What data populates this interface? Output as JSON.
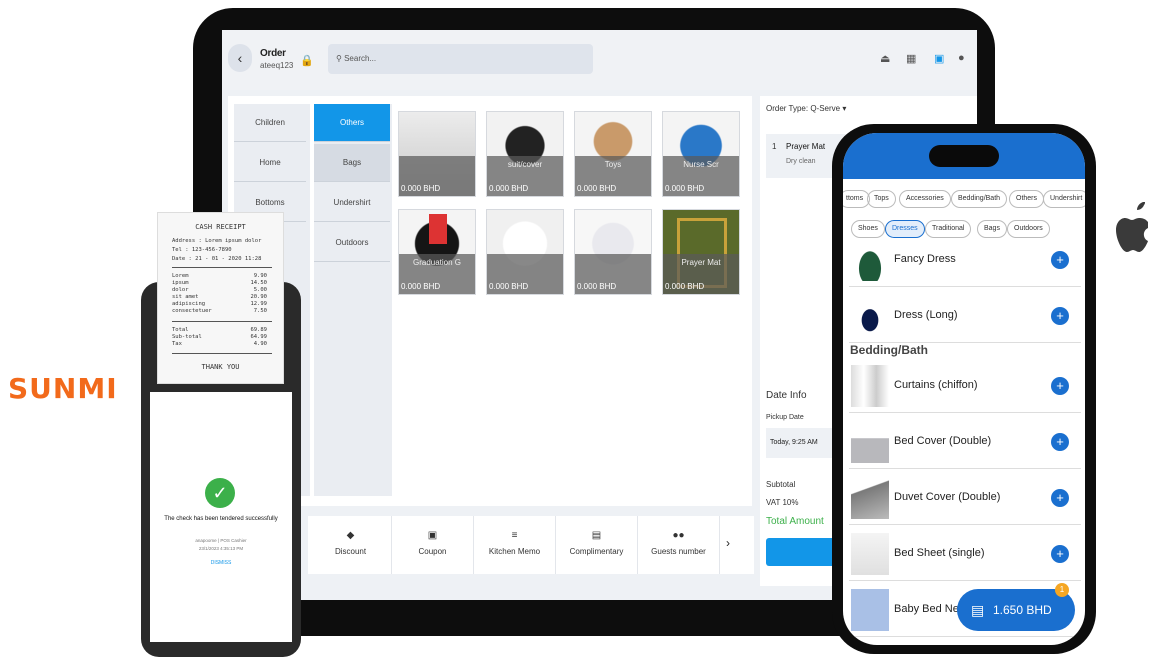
{
  "sunmi_logo": "SUNMI",
  "tablet": {
    "order_title": "Order",
    "order_user": "ateeq123",
    "search_placeholder": "Search...",
    "categories_left": [
      "Children",
      "Home",
      "Bottoms"
    ],
    "categories_right": [
      "Others",
      "Bags",
      "Undershirt",
      "Outdoors"
    ],
    "products": [
      {
        "name": "",
        "price": "0.000 BHD"
      },
      {
        "name": "suit/cover",
        "price": "0.000 BHD"
      },
      {
        "name": "Toys",
        "price": "0.000 BHD"
      },
      {
        "name": "Nurse Scr",
        "price": "0.000 BHD"
      },
      {
        "name": "Graduation G",
        "price": "0.000 BHD"
      },
      {
        "name": "",
        "price": "0.000 BHD"
      },
      {
        "name": "",
        "price": "0.000 BHD"
      },
      {
        "name": "Prayer Mat",
        "price": "0.000 BHD"
      }
    ],
    "actions": [
      "Discount",
      "Coupon",
      "Kitchen Memo",
      "Complimentary",
      "Guests number"
    ],
    "order_type": "Order Type: Q-Serve ▾",
    "line_item": {
      "qty": "1",
      "name": "Prayer Mat",
      "service": "Dry clean"
    },
    "date_info": "Date Info",
    "pickup_label": "Pickup Date",
    "pickup_value": "Today, 9:25 AM",
    "subtotal": "Subtotal",
    "vat": "VAT 10%",
    "total": "Total Amount"
  },
  "phone": {
    "top_chips": [
      "ttoms",
      "Tops",
      "Accessories",
      "Bedding/Bath",
      "Others",
      "Undershirt"
    ],
    "sub_chips": [
      "Shoes",
      "Dresses",
      "Traditional",
      "Bags",
      "Outdoors"
    ],
    "items_a": [
      "Fancy Dress",
      "Dress (Long)"
    ],
    "section": "Bedding/Bath",
    "items_b": [
      "Curtains (chiffon)",
      "Bed Cover (Double)",
      "Duvet Cover (Double)",
      "Bed Sheet (single)",
      "Baby Bed Nest"
    ],
    "cart_total": "1.650 BHD",
    "cart_badge": "1"
  },
  "receipt": {
    "title": "CASH RECEIPT",
    "address": "Address : Lorem ipsum dolor",
    "tel": "Tel : 123-456-7890",
    "date": "Date : 21 - 01 - 2020  11:28",
    "lines": [
      [
        "Lorem",
        "9.90"
      ],
      [
        "ipsum",
        "14.50"
      ],
      [
        "dolor",
        "5.00"
      ],
      [
        "sit amet",
        "20.90"
      ],
      [
        "adipiscing",
        "12.99"
      ],
      [
        "consectetuer",
        "7.50"
      ]
    ],
    "totals": [
      [
        "Total",
        "69.89"
      ],
      [
        "Sub-total",
        "64.99"
      ],
      [
        "Tax",
        "4.90"
      ]
    ],
    "thanks": "THANK YOU"
  },
  "printer_screen": {
    "message": "The check has been tendered successfully",
    "sub1": "anapoome | POS Cashier",
    "sub2": "23/1/2023 4:35:13 PM",
    "dismiss": "DISMISS"
  },
  "colors": {
    "accent": "#1296e8",
    "phone_brand": "#1a6fcf",
    "sunmi": "#f26a1b",
    "success": "#3cb04a"
  }
}
